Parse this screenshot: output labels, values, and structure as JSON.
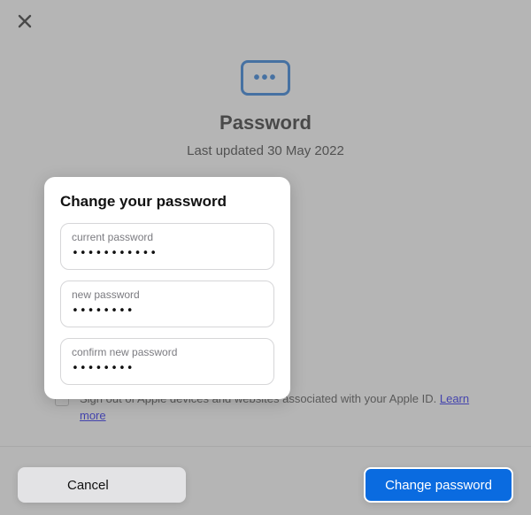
{
  "header": {
    "title": "Password",
    "last_updated": "Last updated 30 May 2022"
  },
  "dialog": {
    "title": "Change your password",
    "fields": {
      "current": {
        "label": "current password",
        "value": "•••••••••••"
      },
      "new": {
        "label": "new password",
        "value": "••••••••"
      },
      "confirm": {
        "label": "confirm new password",
        "value": "••••••••"
      }
    }
  },
  "consent": {
    "text": "Sign out of Apple devices and websites associated with your Apple ID. ",
    "learn_more": "Learn more"
  },
  "buttons": {
    "cancel": "Cancel",
    "change": "Change password"
  },
  "colors": {
    "accent": "#0a6be0"
  }
}
